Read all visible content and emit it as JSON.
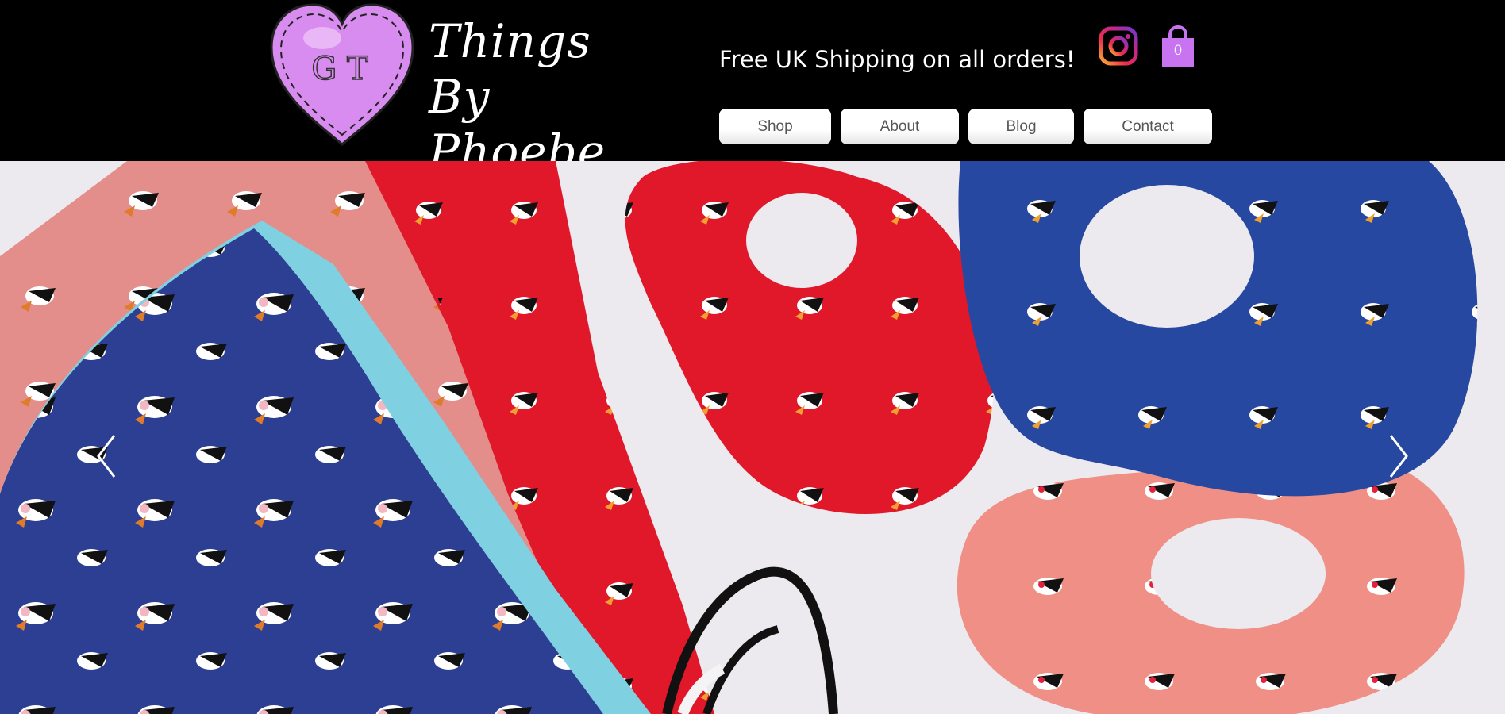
{
  "brand": {
    "line1": "Things By",
    "line2": "Phoebe",
    "logo_initials": "G T"
  },
  "header": {
    "shipping_text": "Free UK Shipping on all orders!"
  },
  "social": {
    "instagram_icon": "instagram-icon"
  },
  "cart": {
    "icon": "shopping-bag-icon",
    "count": "0",
    "accent_color": "#c874f0"
  },
  "nav": {
    "items": [
      {
        "label": "Shop"
      },
      {
        "label": "About"
      },
      {
        "label": "Blog"
      },
      {
        "label": "Contact"
      }
    ]
  },
  "slideshow": {
    "prev_icon": "chevron-left-icon",
    "next_icon": "chevron-right-icon",
    "image": "puffin print face masks and scrunchies"
  },
  "colors": {
    "header_bg": "#000000",
    "logo_heart": "#d98cf0",
    "mask_blue": "#2c3f93",
    "mask_pink": "#e48e8c",
    "mask_red": "#e0182a",
    "scrunchie_blue": "#2748a1",
    "scrunchie_pink": "#ef8f86"
  }
}
